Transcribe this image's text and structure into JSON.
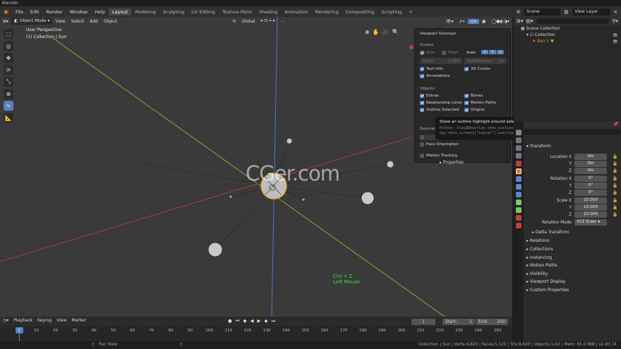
{
  "window_title": "Blender",
  "topbar": {
    "menus": [
      "File",
      "Edit",
      "Render",
      "Window",
      "Help"
    ],
    "workspaces": [
      "Layout",
      "Modeling",
      "Sculpting",
      "UV Editing",
      "Texture Paint",
      "Shading",
      "Animation",
      "Rendering",
      "Compositing",
      "Scripting"
    ],
    "active_workspace": "Layout",
    "add_tab": "+",
    "scene": "Scene",
    "view_layer": "View Layer"
  },
  "viewport": {
    "mode": "Object Mode",
    "menus": [
      "View",
      "Select",
      "Add",
      "Object"
    ],
    "orientation": "Global",
    "perspective": "User Perspective",
    "collection_info": "(1) Collection | Sun",
    "watermark": "CGer.com",
    "shortcut_key": "Ctrl + Z",
    "shortcut_mouse": "Left Mouse"
  },
  "overlay_popover": {
    "title": "Viewport Overlays",
    "guides_heading": "Guides",
    "grid": "Grid",
    "floor": "Floor",
    "axes": "Axes",
    "axis_x": "X",
    "axis_y": "Y",
    "axis_z": "Z",
    "scale_label": "Scale",
    "scale_value": "1.000",
    "subdiv_label": "Subdivisions",
    "subdiv_value": "10",
    "text_info": "Text Info",
    "cursor_3d": "3D Cursor",
    "annotations": "Annotations",
    "objects_heading": "Objects",
    "extras": "Extras",
    "bones": "Bones",
    "relationship_lines": "Relationship Lines",
    "motion_paths": "Motion Paths",
    "outline_selected": "Outline Selected",
    "origins": "Origins",
    "geometry_heading": "Geomet",
    "face_orientation": "Face Orientation",
    "motion_tracking": "Motion Tracking"
  },
  "tooltip": {
    "text": "Show an outline highlight around selected objects.",
    "python1": "Python: View3DOverlay.show_outline_selected",
    "python2": "bpy.data.screens[\"Layout\"].overlay.show_outline_selected"
  },
  "outliner": {
    "scene_collection": "Scene Collection",
    "collection": "Collection",
    "sun": "Sun"
  },
  "properties": {
    "transform": "Transform",
    "location_x_label": "Location X",
    "location_x": "0m",
    "location_y": "0m",
    "location_z": "0m",
    "rotation_x_label": "Rotation X",
    "rotation_x": "0°",
    "rotation_y": "0°",
    "rotation_z": "0°",
    "scale_x_label": "Scale X",
    "scale_x": "10.000",
    "scale_y": "10.000",
    "scale_z": "10.000",
    "y_label": "Y",
    "z_label": "Z",
    "rotation_mode_label": "Rotation Mode",
    "rotation_mode": "XYZ Euler",
    "delta_transform": "Delta Transform",
    "sections": [
      "Relations",
      "Collections",
      "Instancing",
      "Motion Paths",
      "Visibility",
      "Viewport Display",
      "Custom Properties"
    ],
    "properties_partial": "Properties"
  },
  "timeline": {
    "menus": [
      "Playback",
      "Keying",
      "View",
      "Marker"
    ],
    "current_frame": "1",
    "start_label": "Start:",
    "start": "1",
    "end_label": "End:",
    "end": "250",
    "ticks": [
      "1",
      "10",
      "20",
      "30",
      "40",
      "50",
      "60",
      "70",
      "80",
      "90",
      "100",
      "110",
      "120",
      "130",
      "140",
      "150",
      "160",
      "170",
      "180",
      "190",
      "200",
      "210",
      "220",
      "230",
      "240",
      "250"
    ]
  },
  "statusbar": {
    "pan": "Pan View",
    "stats": "Collection | Sun | Verts:4,820 | Faces:5,120 | Tris:9,600 | Objects:1/10 | Mem: 65.0 MiB | v2.80.74"
  },
  "colors": {
    "accent": "#5680c2",
    "selected_orange": "#f5a623",
    "x_axis": "#c23b4e",
    "y_axis": "#b5b53c",
    "z_axis": "#4b79c4",
    "shortcut_green": "#44dd44"
  }
}
